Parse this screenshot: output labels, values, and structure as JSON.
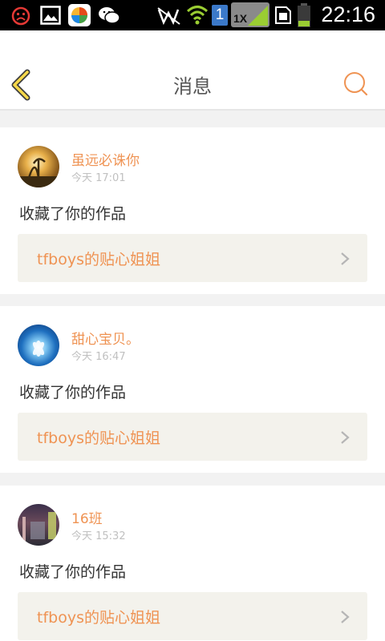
{
  "status_bar": {
    "time": "22:16",
    "sim_badge": "1",
    "network_badge": "1X",
    "icons": [
      "notification-sad-icon",
      "gallery-icon",
      "app-store-icon",
      "wechat-icon",
      "mute-icon",
      "wifi-icon",
      "sim-1-icon",
      "signal-1x-icon",
      "sim-card-icon",
      "battery-icon"
    ]
  },
  "header": {
    "title": "消息",
    "back_icon": "back-chevron-icon",
    "search_icon": "search-icon",
    "accent_color": "#ef9353"
  },
  "messages": [
    {
      "user": "虽远必诛你",
      "time": "今天 17:01",
      "action": "收藏了你的作品",
      "work": "tfboys的贴心姐姐"
    },
    {
      "user": "甜心宝贝。",
      "time": "今天 16:47",
      "action": "收藏了你的作品",
      "work": "tfboys的贴心姐姐"
    },
    {
      "user": "16班",
      "time": "今天 15:32",
      "action": "收藏了你的作品",
      "work": "tfboys的贴心姐姐"
    }
  ]
}
